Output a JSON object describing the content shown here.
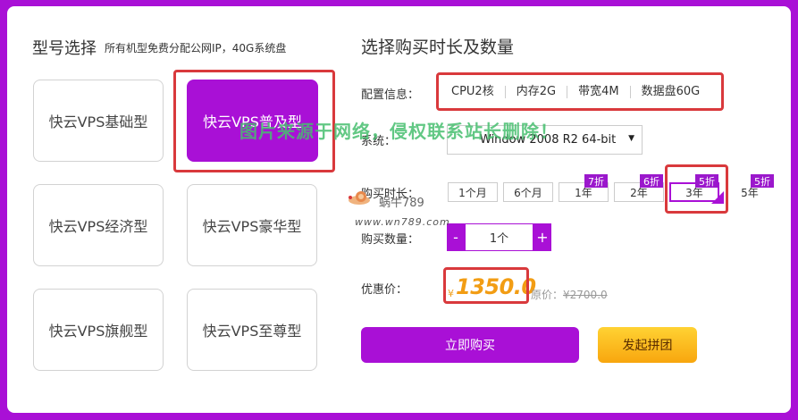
{
  "left": {
    "title": "型号选择",
    "subtitle": "所有机型免费分配公网IP，40G系统盘",
    "models": [
      {
        "label": "快云VPS基础型"
      },
      {
        "label": "快云VPS普及型"
      },
      {
        "label": "快云VPS经济型"
      },
      {
        "label": "快云VPS豪华型"
      },
      {
        "label": "快云VPS旗舰型"
      },
      {
        "label": "快云VPS至尊型"
      }
    ],
    "selected_model": "快云VPS普及型"
  },
  "right": {
    "title": "选择购买时长及数量",
    "config_label": "配置信息：",
    "config_items": [
      "CPU2核",
      "内存2G",
      "带宽4M",
      "数据盘60G"
    ],
    "os_label": "系统：",
    "os_value": "Window 2008 R2 64-bit",
    "os_arrow": "▼",
    "duration_label": "购买时长：",
    "durations": [
      {
        "label": "1个月",
        "badge": ""
      },
      {
        "label": "6个月",
        "badge": ""
      },
      {
        "label": "1年",
        "badge": "7折"
      },
      {
        "label": "2年",
        "badge": "6折"
      },
      {
        "label": "3年",
        "badge": "5折"
      },
      {
        "label": "5年",
        "badge": "5折"
      }
    ],
    "selected_duration": "3年",
    "qty_label": "购买数量：",
    "qty_minus": "-",
    "qty_value": "1个",
    "qty_plus": "+",
    "price_label": "优惠价：",
    "currency": "¥",
    "price": "1350.0",
    "orig_prefix": "原价：",
    "orig_price": "¥2700.0",
    "buy_button": "立即购买",
    "group_button": "发起拼团"
  },
  "watermark": {
    "text": "图片来源于网络，侵权联系站长删除！",
    "name": "蜗牛789",
    "url": "www.wn789.com"
  },
  "colors": {
    "accent": "#a910d6",
    "highlight_border": "#d9393c",
    "price": "#f29d14",
    "group_button": "#f8b41a"
  }
}
